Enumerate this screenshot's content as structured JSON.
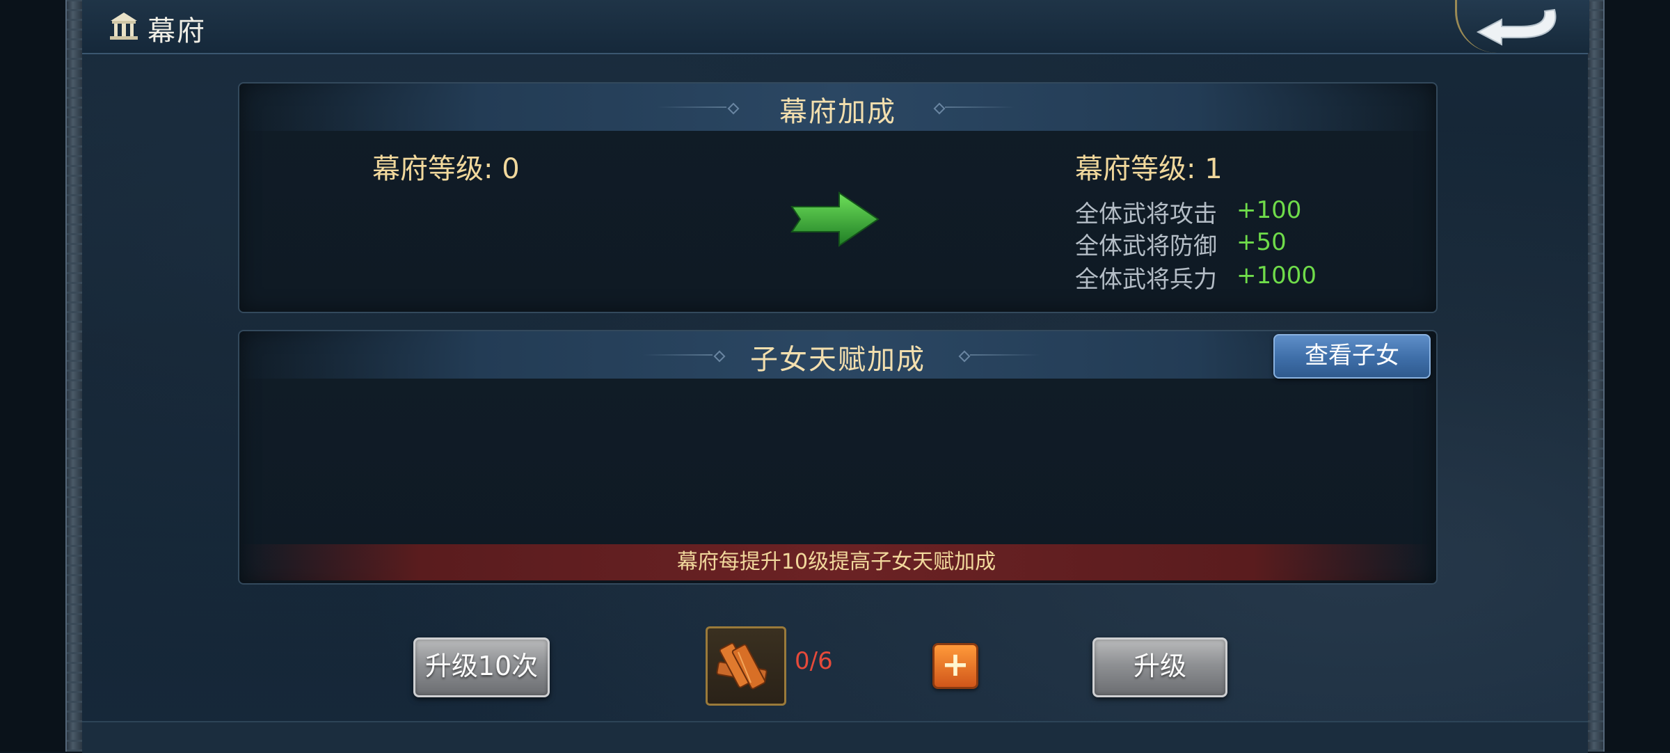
{
  "header": {
    "title": "幕府",
    "title_icon": "palace-icon",
    "back_icon": "return-arrow-icon"
  },
  "bonus_panel": {
    "title": "幕府加成",
    "current_level": "幕府等级: 0",
    "next_level": "幕府等级: 1",
    "arrow_icon": "green-arrow-icon",
    "stats": [
      {
        "label": "全体武将攻击",
        "value": "+100"
      },
      {
        "label": "全体武将防御",
        "value": "+50"
      },
      {
        "label": "全体武将兵力",
        "value": "+1000"
      }
    ]
  },
  "children_panel": {
    "title": "子女天赋加成",
    "view_button": "查看子女",
    "notice": "幕府每提升10级提高子女天赋加成"
  },
  "footer": {
    "upgrade_10_button": "升级10次",
    "material_icon": "wood-planks-icon",
    "material_count": "0/6",
    "add_icon": "plus-icon",
    "upgrade_button": "升级"
  },
  "colors": {
    "gold_text": "#f1d89c",
    "stat_green": "#6fdc4a",
    "count_red": "#e64a3a",
    "view_button_blue": "#3e6ea8"
  }
}
